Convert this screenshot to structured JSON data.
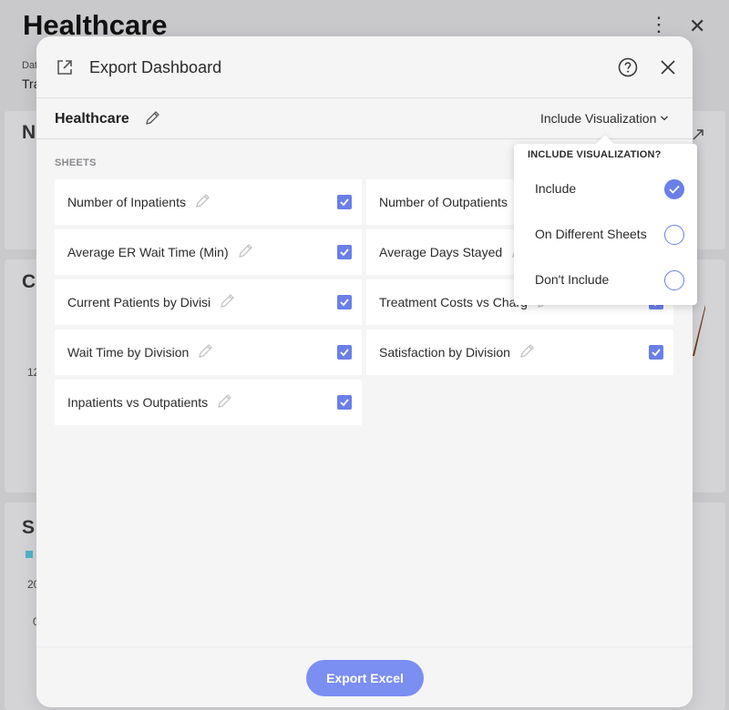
{
  "background": {
    "title": "Healthcare",
    "label_partial": "Dat",
    "sublabel_partial": "Tra",
    "card1_partial": "N",
    "card2_partial": "C",
    "card3_partial": "S",
    "axis_partial_1": "12",
    "axis_partial_2": "20",
    "axis_partial_3": "0"
  },
  "modal": {
    "title": "Export Dashboard",
    "dashboard_name": "Healthcare",
    "visualization_dropdown_label": "Include Visualization",
    "sheets_header": "SHEETS",
    "export_button_label": "Export Excel",
    "sheets": [
      {
        "label": "Number of Inpatients",
        "checked": true
      },
      {
        "label": "Number of Outpatients",
        "checked": true
      },
      {
        "label": "Average ER Wait Time (Min)",
        "checked": true
      },
      {
        "label": "Average Days Stayed",
        "checked": true
      },
      {
        "label": "Current Patients by Divisi",
        "checked": true
      },
      {
        "label": "Treatment Costs vs Charg",
        "checked": true
      },
      {
        "label": "Wait Time by Division",
        "checked": true
      },
      {
        "label": "Satisfaction by Division",
        "checked": true
      },
      {
        "label": "Inpatients vs Outpatients",
        "checked": true
      }
    ]
  },
  "popup": {
    "title": "INCLUDE VISUALIZATION?",
    "options": [
      {
        "label": "Include",
        "selected": true
      },
      {
        "label": "On Different Sheets",
        "selected": false
      },
      {
        "label": "Don't Include",
        "selected": false
      }
    ]
  },
  "colors": {
    "accent": "#6b7fe8",
    "button": "#7b8ef2",
    "overlay": "#c9c9cc"
  }
}
